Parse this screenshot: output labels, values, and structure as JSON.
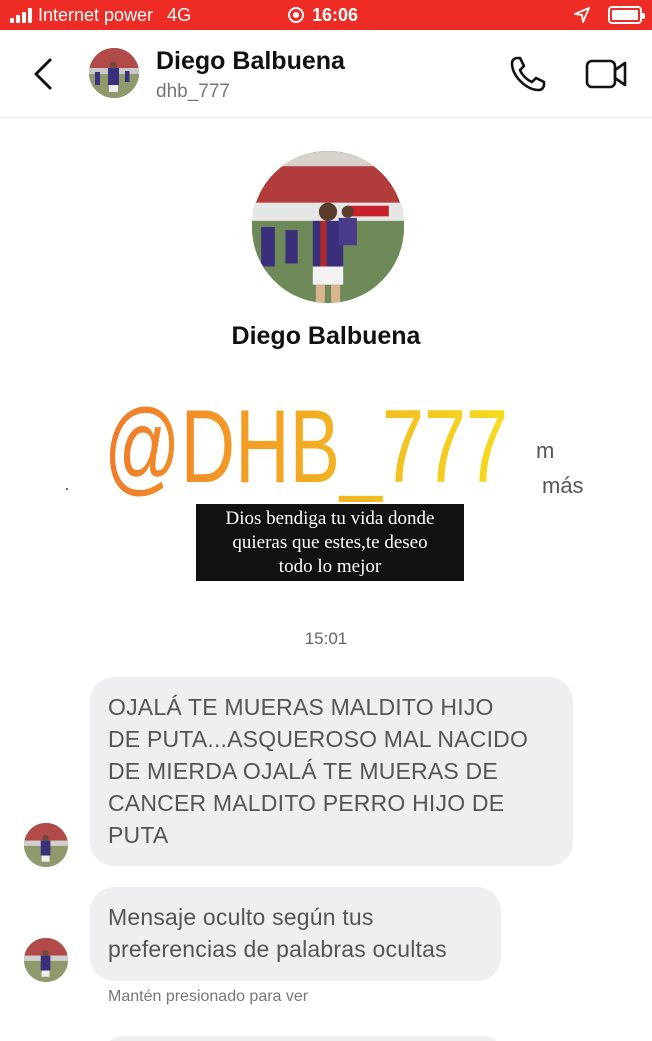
{
  "status_bar": {
    "carrier": "Internet power",
    "network": "4G",
    "time": "16:06"
  },
  "header": {
    "name": "Diego Balbuena",
    "username": "dhb_777",
    "icons": [
      "back-icon",
      "phone-icon",
      "video-icon"
    ]
  },
  "profile": {
    "name": "Diego Balbuena"
  },
  "watermark": {
    "text": "@DHB_777",
    "fragment_m": "m",
    "fragment_mas": "más",
    "fragment_dot": "·"
  },
  "caption": {
    "lines": [
      "Dios bendiga tu vida donde",
      "quieras que estes,te deseo",
      "todo lo mejor"
    ]
  },
  "conversation": {
    "timestamp": "15:01",
    "messages": [
      {
        "lines": [
          "OJALÁ TE MUERAS MALDITO HIJO",
          "DE PUTA...ASQUEROSO MAL NACIDO",
          "DE MIERDA OJALÁ TE MUERAS DE",
          "CANCER MALDITO PERRO HIJO DE",
          "PUTA"
        ]
      },
      {
        "lines": [
          "Mensaje oculto según tus",
          "preferencias de palabras ocultas"
        ],
        "hint": "Mantén presionado para ver"
      }
    ]
  },
  "colors": {
    "status_bar": "#ee2b24",
    "bubble": "#efeff1",
    "watermark_start": "#f07a2a",
    "watermark_end": "#f6dc1c"
  }
}
